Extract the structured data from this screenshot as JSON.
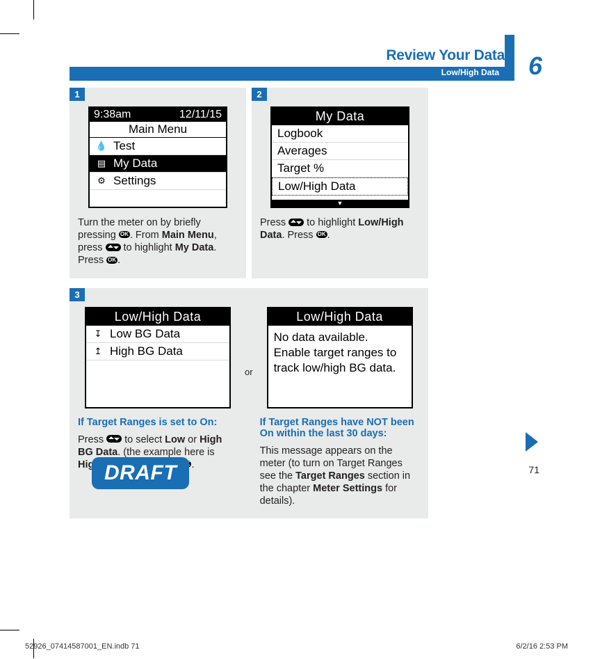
{
  "header": {
    "title": "Review Your Data",
    "subtitle": "Low/High Data",
    "chapter": "6"
  },
  "steps": {
    "s1": {
      "num": "1",
      "lcd": {
        "time": "9:38am",
        "date": "12/11/15",
        "title": "Main Menu",
        "rows": [
          "Test",
          "My Data",
          "Settings"
        ]
      },
      "text_pre": "Turn the meter on by briefly pressing ",
      "text_mid1": ". From ",
      "b1": "Main Menu",
      "text_mid2": ", press ",
      "text_mid3": " to highlight ",
      "b2": "My Data",
      "text_end1": ". Press ",
      "text_end2": "."
    },
    "s2": {
      "num": "2",
      "lcd": {
        "title": "My Data",
        "rows": [
          "Logbook",
          "Averages",
          "Target %",
          "Low/High Data"
        ]
      },
      "text_pre": "Press ",
      "text_mid1": " to highlight ",
      "b1": "Low/High Data",
      "text_mid2": ". Press ",
      "text_end": "."
    },
    "s3": {
      "num": "3",
      "left": {
        "lcd": {
          "title": "Low/High Data",
          "rows": [
            "Low BG Data",
            "High BG Data"
          ]
        },
        "heading": "If Target Ranges is set to On:",
        "t_pre": "Press ",
        "t_mid1": " to select ",
        "b1": "Low",
        "t_or": " or ",
        "b2": "High BG Data",
        "t_mid2": ". (the example here is ",
        "b3": "High BG Data",
        "t_mid3": "). Press ",
        "t_end": "."
      },
      "or": "or",
      "right": {
        "lcd": {
          "title": "Low/High Data",
          "message": "No data available. Enable target ranges to track low/high BG data."
        },
        "heading": "If Target Ranges have NOT been On within the last 30 days:",
        "t_pre": "This message appears on the meter (to turn on Target Ranges see the ",
        "b1": "Target Ranges",
        "t_mid1": " section in the chapter ",
        "b2": "Meter Settings",
        "t_end": " for details)."
      }
    }
  },
  "footer": {
    "draft": "DRAFT",
    "page_num": "71",
    "left": "52926_07414587001_EN.indb   71",
    "right": "6/2/16   2:53 PM"
  }
}
